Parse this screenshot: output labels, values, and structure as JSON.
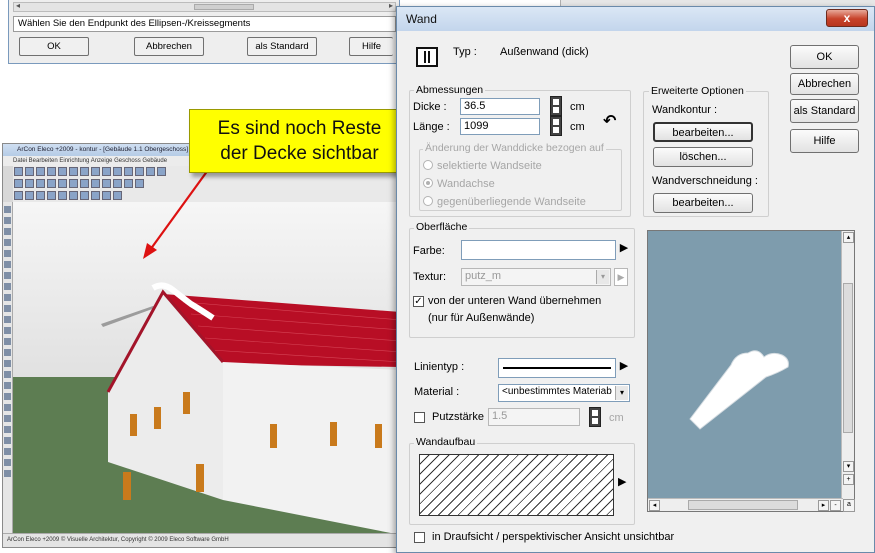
{
  "top_dialog": {
    "status_text": "Wählen Sie den Endpunkt des Ellipsen-/Kreissegments",
    "ok_label": "OK",
    "cancel_label": "Abbrechen",
    "default_label": "als Standard",
    "help_label": "Hilfe"
  },
  "cad_app": {
    "title": "ArCon Eleco +2009 - kontur - [Gebäude 1.1 Obergeschoss]",
    "menu": "Datei  Bearbeiten  Einrichtung  Anzeige  Geschoss  Gebäude",
    "status": "ArCon Eleco +2009 © Visuelle Architektur, Copyright © 2009 Eleco Software GmbH"
  },
  "callout": {
    "line1": "Es sind noch Reste",
    "line2": "der Decke sichtbar"
  },
  "wand": {
    "title": "Wand",
    "close_label": "x",
    "typ_label": "Typ :",
    "typ_value": "Außenwand (dick)",
    "ok_label": "OK",
    "cancel_label": "Abbrechen",
    "default_label": "als Standard",
    "help_label": "Hilfe",
    "abmessungen": {
      "title": "Abmessungen",
      "dicke_label": "Dicke :",
      "dicke_value": "36.5",
      "laenge_label": "Länge :",
      "laenge_value": "1099",
      "unit": "cm",
      "change_title": "Änderung der Wanddicke bezogen auf",
      "options": [
        "selektierte Wandseite",
        "Wandachse",
        "gegenüberliegende Wandseite"
      ],
      "selected_index": 1
    },
    "erweitert": {
      "title": "Erweiterte Optionen",
      "kontur_label": "Wandkontur :",
      "bearbeiten1": "bearbeiten...",
      "loeschen": "löschen...",
      "verschneidung_label": "Wandverschneidung :",
      "bearbeiten2": "bearbeiten..."
    },
    "oberflaeche": {
      "title": "Oberfläche",
      "farbe_label": "Farbe:",
      "textur_label": "Textur:",
      "textur_value": "putz_m",
      "checkbox_label1": "von der unteren Wand übernehmen",
      "checkbox_label2": "(nur für Außenwände)",
      "checked": true
    },
    "linientyp_label": "Linientyp :",
    "material_label": "Material :",
    "material_value": "<unbestimmtes Materiab",
    "putz_label": "Putzstärke",
    "putz_value": "1.5",
    "putz_unit": "cm",
    "wandaufbau_title": "Wandaufbau",
    "bottom_checkbox": "in Draufsicht / perspektivischer Ansicht unsichtbar",
    "scroll_minus": "-",
    "scroll_a": "a"
  },
  "colors": {
    "callout_bg": "#ffff00",
    "preview_bg": "#7e9cad",
    "roof": "#c8102e",
    "close_button": "#c7422a"
  }
}
